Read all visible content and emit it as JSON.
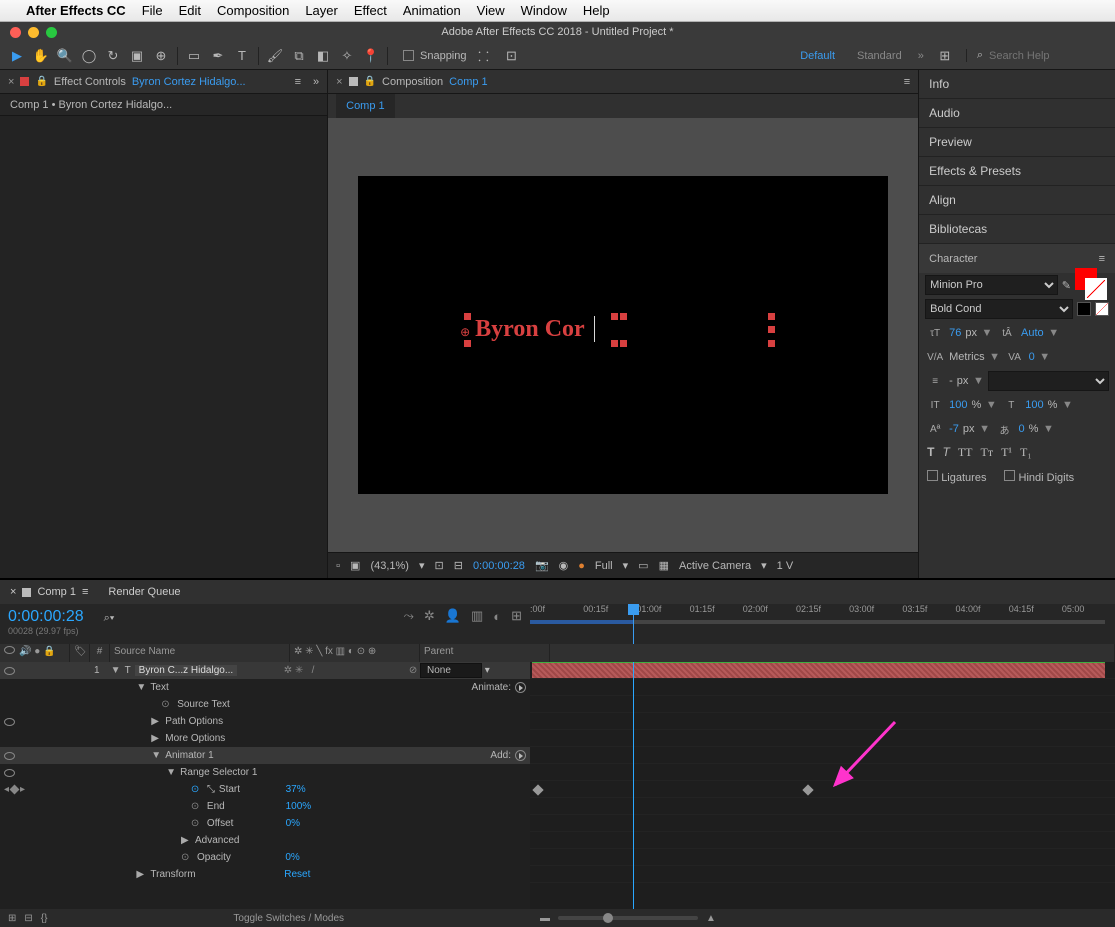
{
  "mac_menu": {
    "app": "After Effects CC",
    "items": [
      "File",
      "Edit",
      "Composition",
      "Layer",
      "Effect",
      "Animation",
      "View",
      "Window",
      "Help"
    ]
  },
  "window_title": "Adobe After Effects CC 2018 - Untitled Project *",
  "toolbar": {
    "snapping": "Snapping",
    "ws_default": "Default",
    "ws_standard": "Standard",
    "search_ph": "Search Help"
  },
  "ec": {
    "panel": "Effect Controls",
    "layer": "Byron Cortez Hidalgo...",
    "sub": "Comp 1 • Byron Cortez Hidalgo..."
  },
  "comp": {
    "panel": "Composition",
    "name": "Comp 1",
    "tab": "Comp 1",
    "text_content": "Byron Cor",
    "footer": {
      "zoom": "(43,1%)",
      "time": "0:00:00:28",
      "res": "Full",
      "camera": "Active Camera",
      "views": "1 V"
    }
  },
  "right": {
    "info": "Info",
    "audio": "Audio",
    "preview": "Preview",
    "effects": "Effects & Presets",
    "align": "Align",
    "libraries": "Bibliotecas",
    "char": {
      "title": "Character",
      "font": "Minion Pro",
      "style": "Bold Cond",
      "size": "76",
      "size_unit": "px",
      "leading": "Auto",
      "kerning": "Metrics",
      "tracking": "0",
      "stroke": "-",
      "stroke_unit": "px",
      "vscale": "100",
      "vscale_unit": "%",
      "hscale": "100",
      "hscale_unit": "%",
      "baseline": "-7",
      "baseline_unit": "px",
      "tsume": "0",
      "tsume_unit": "%",
      "ligatures": "Ligatures",
      "hindi": "Hindi Digits"
    }
  },
  "timeline": {
    "tab1": "Comp 1",
    "tab2": "Render Queue",
    "timecode": "0:00:00:28",
    "timecode_sub": "00028 (29.97 fps)",
    "ruler": [
      ":00f",
      "00:15f",
      "01:00f",
      "01:15f",
      "02:00f",
      "02:15f",
      "03:00f",
      "03:15f",
      "04:00f",
      "04:15f",
      "05:00"
    ],
    "cols": {
      "source": "Source Name",
      "parent": "Parent"
    },
    "layer": {
      "num": "1",
      "name": "Byron C...z Hidalgo...",
      "parent": "None"
    },
    "rows": {
      "text": "Text",
      "animate": "Animate:",
      "source_text": "Source Text",
      "path_options": "Path Options",
      "more_options": "More Options",
      "animator": "Animator 1",
      "add": "Add:",
      "range_selector": "Range Selector 1",
      "start": "Start",
      "start_val": "37%",
      "end": "End",
      "end_val": "100%",
      "offset": "Offset",
      "offset_val": "0%",
      "advanced": "Advanced",
      "opacity": "Opacity",
      "opacity_val": "0%",
      "transform": "Transform",
      "reset": "Reset"
    },
    "toggle": "Toggle Switches / Modes"
  }
}
